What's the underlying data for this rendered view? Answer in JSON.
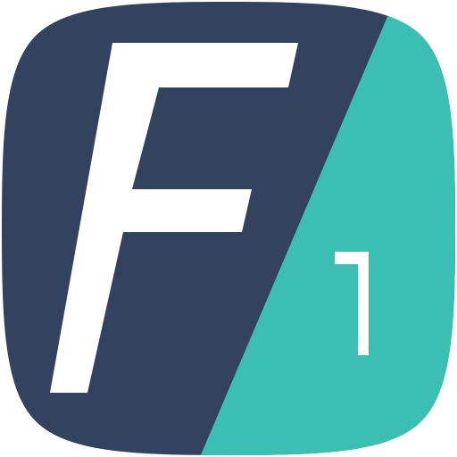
{
  "app_icon": {
    "letter": "F",
    "number": "1",
    "colors": {
      "primary": "#33435f",
      "accent": "#3bbfb2",
      "glyph": "#ffffff"
    }
  }
}
